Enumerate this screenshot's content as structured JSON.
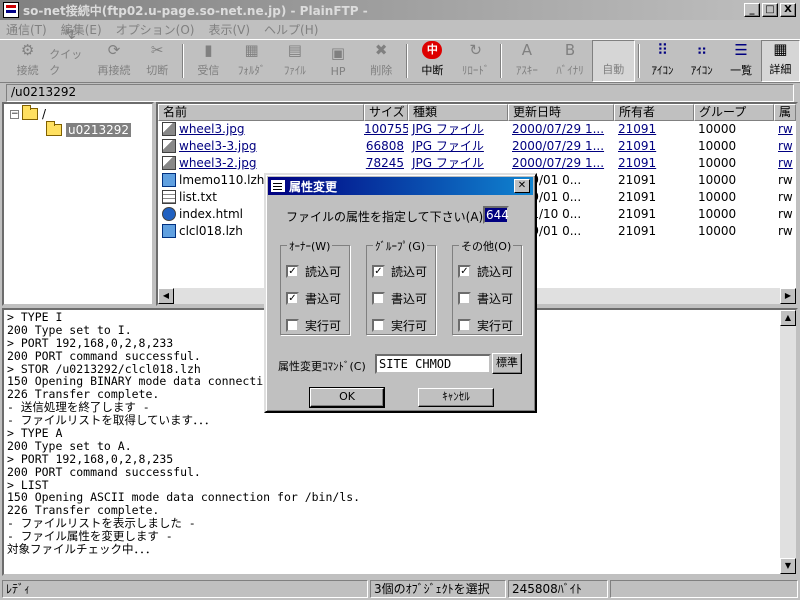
{
  "window": {
    "title": "so-net接続中(ftp02.u-page.so-net.ne.jp) - PlainFTP -",
    "controls": [
      "_",
      "□",
      "X"
    ]
  },
  "menu": [
    "通信(T)",
    "編集(E)",
    "オプション(O)",
    "表示(V)",
    "ヘルプ(H)"
  ],
  "toolbar": {
    "buttons": [
      {
        "label": "接続",
        "icon": "connect-icon",
        "glyph": "⚙"
      },
      {
        "label": "クイック",
        "icon": "quick-connect-icon",
        "glyph": "↯"
      },
      {
        "label": "再接続",
        "icon": "reconnect-icon",
        "glyph": "⟳"
      },
      {
        "label": "切断",
        "icon": "disconnect-icon",
        "glyph": "✂"
      },
      {
        "label": "受信",
        "icon": "download-icon",
        "glyph": "▮"
      },
      {
        "label": "ﾌｫﾙﾀﾞ",
        "icon": "folder-icon",
        "glyph": "▦"
      },
      {
        "label": "ﾌｧｲﾙ",
        "icon": "file-icon",
        "glyph": "▤"
      },
      {
        "label": "HP",
        "icon": "homepage-icon",
        "glyph": "▣"
      },
      {
        "label": "削除",
        "icon": "delete-icon",
        "glyph": "✖"
      },
      {
        "label": "中断",
        "icon": "abort-icon",
        "glyph": "中"
      },
      {
        "label": "ﾘﾛｰﾄﾞ",
        "icon": "reload-icon",
        "glyph": "↻"
      },
      {
        "label": "ｱｽｷｰ",
        "icon": "ascii-icon",
        "glyph": "A"
      },
      {
        "label": "ﾊﾞｲﾅﾘ",
        "icon": "binary-icon",
        "glyph": "B"
      },
      {
        "label": "自動",
        "icon": "auto-icon",
        "glyph": " "
      },
      {
        "label": "ｱｲｺﾝ",
        "icon": "large-icon-view-icon",
        "glyph": "⠿"
      },
      {
        "label": "ｱｲｺﾝ",
        "icon": "small-icon-view-icon",
        "glyph": "⠶"
      },
      {
        "label": "一覧",
        "icon": "list-view-icon",
        "glyph": "☰"
      },
      {
        "label": "詳細",
        "icon": "details-view-icon",
        "glyph": "▦"
      }
    ]
  },
  "path": "/u0213292",
  "tree": {
    "root": "/",
    "child": "u0213292",
    "expander": "−"
  },
  "list": {
    "columns": [
      "名前",
      "サイズ",
      "種類",
      "更新日時",
      "所有者",
      "グループ",
      "属"
    ],
    "rows": [
      {
        "name": "wheel3.jpg",
        "size": "100755",
        "type": "JPG ファイル",
        "date": "2000/07/29 1...",
        "owner": "21091",
        "group": "10000",
        "attr": "rw",
        "icon": "image-file-icon",
        "link": true
      },
      {
        "name": "wheel3-3.jpg",
        "size": "66808",
        "type": "JPG ファイル",
        "date": "2000/07/29 1...",
        "owner": "21091",
        "group": "10000",
        "attr": "rw",
        "icon": "image-file-icon",
        "link": true
      },
      {
        "name": "wheel3-2.jpg",
        "size": "78245",
        "type": "JPG ファイル",
        "date": "2000/07/29 1...",
        "owner": "21091",
        "group": "10000",
        "attr": "rw",
        "icon": "image-file-icon",
        "link": true
      },
      {
        "name": "lmemo110.lzh",
        "size": "",
        "type": "",
        "date": "0/09/01 0...",
        "owner": "21091",
        "group": "10000",
        "attr": "rw",
        "icon": "archive-file-icon",
        "link": false
      },
      {
        "name": "list.txt",
        "size": "",
        "type": "",
        "date": "0/09/01 0...",
        "owner": "21091",
        "group": "10000",
        "attr": "rw",
        "icon": "text-file-icon",
        "link": false
      },
      {
        "name": "index.html",
        "size": "",
        "type": "",
        "date": "9/11/10 0...",
        "owner": "21091",
        "group": "10000",
        "attr": "rw",
        "icon": "html-file-icon",
        "link": false
      },
      {
        "name": "clcl018.lzh",
        "size": "",
        "type": "",
        "date": "0/09/01 0...",
        "owner": "21091",
        "group": "10000",
        "attr": "rw",
        "icon": "archive-file-icon",
        "link": false
      }
    ]
  },
  "log": [
    "> TYPE I",
    "200 Type set to I.",
    "> PORT 192,168,0,2,8,233",
    "200 PORT command successful.",
    "> STOR /u0213292/clcl018.lzh",
    "150 Opening BINARY mode data connecti",
    "226 Transfer complete.",
    "- 送信処理を終了します -",
    "- ファイルリストを取得しています．．．",
    "> TYPE A",
    "200 Type set to A.",
    "> PORT 192,168,0,2,8,235",
    "200 PORT command successful.",
    "> LIST",
    "150 Opening ASCII mode data connection for /bin/ls.",
    "226 Transfer complete.",
    "- ファイルリストを表示しました -",
    "- ファイル属性を変更します -",
    "対象ファイルチェック中．．．"
  ],
  "status": {
    "state": "ﾚﾃﾞｨ",
    "selection": "3個のｵﾌﾞｼﾞｪｸﾄを選択",
    "bytes": "245808ﾊﾞｲﾄ"
  },
  "dialog": {
    "title": "属性変更",
    "prompt": "ファイルの属性を指定して下さい(A)",
    "value": "644",
    "groups": [
      {
        "label": "ｵｰﾅｰ(W)",
        "items": [
          {
            "label": "読込可",
            "checked": true
          },
          {
            "label": "書込可",
            "checked": true
          },
          {
            "label": "実行可",
            "checked": false
          }
        ]
      },
      {
        "label": "ｸﾞﾙｰﾌﾟ(G)",
        "items": [
          {
            "label": "読込可",
            "checked": true
          },
          {
            "label": "書込可",
            "checked": false
          },
          {
            "label": "実行可",
            "checked": false
          }
        ]
      },
      {
        "label": "その他(O)",
        "items": [
          {
            "label": "読込可",
            "checked": true
          },
          {
            "label": "書込可",
            "checked": false
          },
          {
            "label": "実行可",
            "checked": false
          }
        ]
      }
    ],
    "command_label": "属性変更ｺﾏﾝﾄﾞ(C)",
    "command_value": "SITE CHMOD",
    "default_button": "標準",
    "ok": "OK",
    "cancel": "ｷｬﾝｾﾙ",
    "close": "✕"
  }
}
